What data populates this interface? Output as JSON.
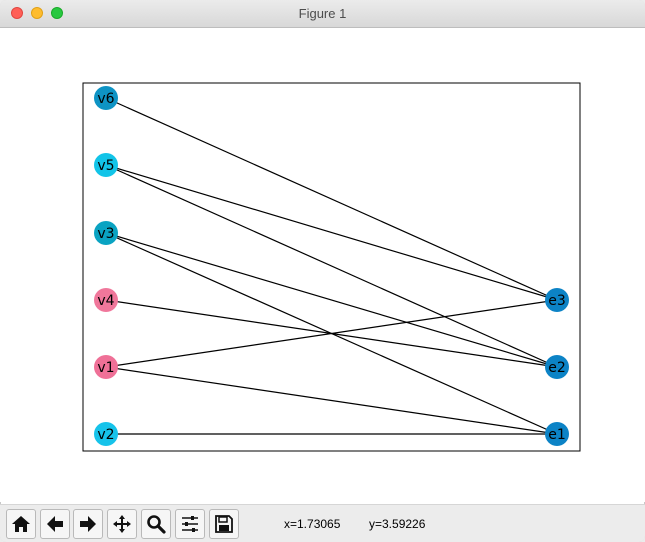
{
  "window": {
    "title": "Figure 1"
  },
  "statusbar": {
    "x_text": "x=1.73065",
    "y_text": "y=3.59226"
  },
  "toolbar": {
    "buttons": [
      {
        "name": "home-button",
        "icon": "home-icon"
      },
      {
        "name": "back-button",
        "icon": "arrow-left-icon"
      },
      {
        "name": "forward-button",
        "icon": "arrow-right-icon"
      },
      {
        "name": "pan-button",
        "icon": "move-icon"
      },
      {
        "name": "zoom-button",
        "icon": "magnifier-icon"
      },
      {
        "name": "configure-subplots-button",
        "icon": "sliders-icon"
      },
      {
        "name": "save-button",
        "icon": "floppy-disk-icon"
      }
    ]
  },
  "graph": {
    "nodes": [
      {
        "id": "v6",
        "label": "v6",
        "color": "#0e93c4"
      },
      {
        "id": "v5",
        "label": "v5",
        "color": "#12c4e8"
      },
      {
        "id": "v3",
        "label": "v3",
        "color": "#0aa3c2"
      },
      {
        "id": "v4",
        "label": "v4",
        "color": "#f0779b"
      },
      {
        "id": "v1",
        "label": "v1",
        "color": "#ef7097"
      },
      {
        "id": "v2",
        "label": "v2",
        "color": "#16c3ea"
      },
      {
        "id": "e3",
        "label": "e3",
        "color": "#0c83c6"
      },
      {
        "id": "e2",
        "label": "e2",
        "color": "#0c83c6"
      },
      {
        "id": "e1",
        "label": "e1",
        "color": "#0c83c6"
      }
    ],
    "edges": [
      [
        "v6",
        "e3"
      ],
      [
        "v5",
        "e3"
      ],
      [
        "v5",
        "e2"
      ],
      [
        "v3",
        "e2"
      ],
      [
        "v3",
        "e1"
      ],
      [
        "v4",
        "e2"
      ],
      [
        "v1",
        "e3"
      ],
      [
        "v1",
        "e1"
      ],
      [
        "v2",
        "e1"
      ]
    ]
  }
}
